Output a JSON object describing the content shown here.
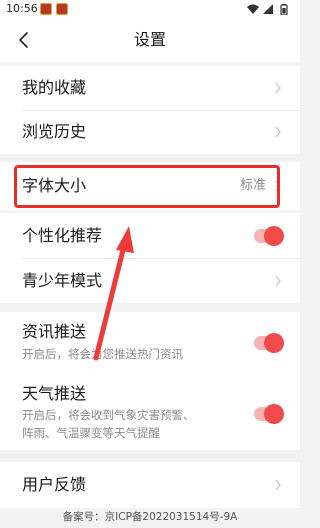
{
  "status_bar": {
    "time": "10:56"
  },
  "nav": {
    "title": "设置"
  },
  "menu": {
    "favorites": {
      "label": "我的收藏"
    },
    "history": {
      "label": "浏览历史"
    },
    "font_size": {
      "label": "字体大小",
      "value": "标准"
    },
    "personalized": {
      "label": "个性化推荐",
      "enabled": true
    },
    "youth_mode": {
      "label": "青少年模式"
    },
    "news_push": {
      "label": "资讯推送",
      "description": "开启后，将会为您推送热门资讯",
      "enabled": true
    },
    "weather_push": {
      "label": "天气推送",
      "description_line1": "开启后，将会收到气象灾害预警、",
      "description_line2": "阵雨、气温骤变等天气提醒",
      "enabled": true
    },
    "feedback": {
      "label": "用户反馈"
    }
  },
  "footer": {
    "icp": "备案号：京ICP备2022031514号-9A"
  },
  "colors": {
    "accent": "#ef4b4b",
    "highlight": "#e92d2d"
  }
}
